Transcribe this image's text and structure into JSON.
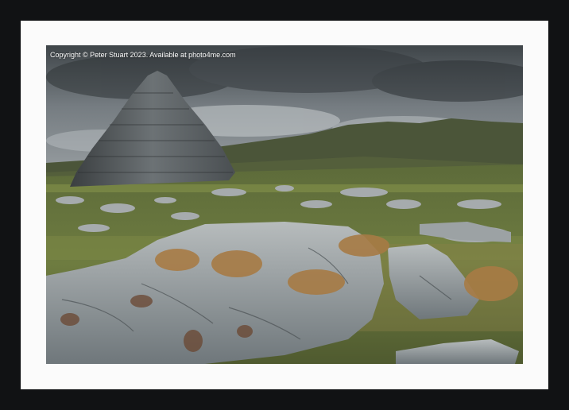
{
  "photo": {
    "copyright": "Copyright © Peter Stuart 2023. Available at photo4me.com"
  },
  "colors": {
    "frame": "#111214",
    "mount": "#fbfbfb",
    "sky": "#6b7278",
    "grass": "#7c8a3f",
    "rock": "#8e969a"
  },
  "icons": [
    "stone-cairn",
    "limestone-rocks",
    "distant-hills",
    "cloudy-sky"
  ]
}
